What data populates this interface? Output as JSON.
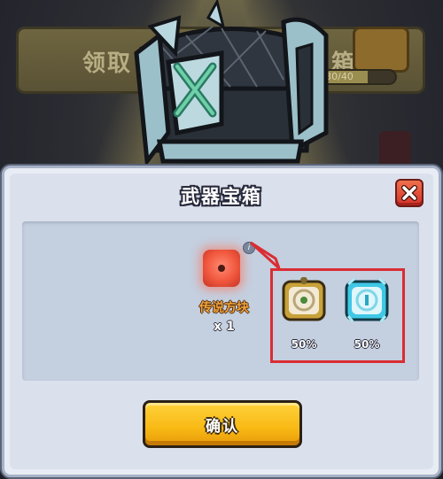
{
  "background": {
    "banner_left_text": "领取",
    "banner_right_text": "宝箱",
    "progress_text": "30/40",
    "progress_fraction": 0.75
  },
  "dialog": {
    "title": "武器宝箱",
    "item": {
      "name": "传说方块",
      "count": "x 1",
      "icon": "legendary-cube-icon",
      "color": "#f0573d"
    },
    "info_icon_text": "i",
    "rewards": [
      {
        "icon": "gold-weapon-crate-icon",
        "chance": "50%",
        "color": "#c8a23a"
      },
      {
        "icon": "blue-weapon-crate-icon",
        "chance": "50%",
        "color": "#3fc8e6"
      }
    ],
    "confirm_label": "确认",
    "highlight_color": "#d92d33"
  }
}
